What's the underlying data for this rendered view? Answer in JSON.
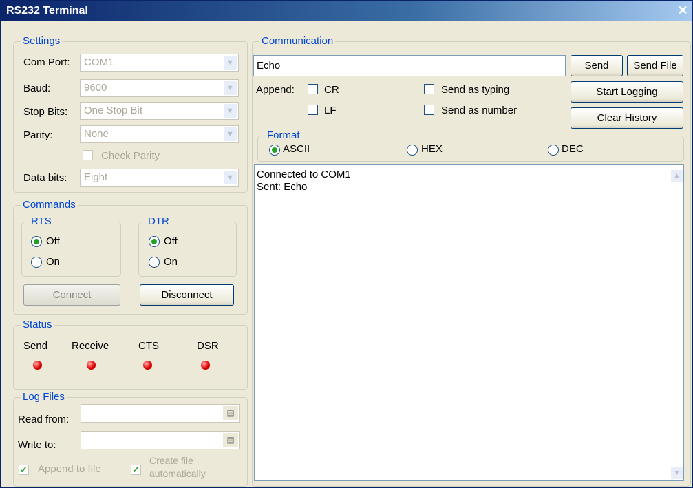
{
  "window": {
    "title": "RS232 Terminal",
    "close": "✕"
  },
  "settings": {
    "legend": "Settings",
    "com_port": {
      "label": "Com Port:",
      "value": "COM1"
    },
    "baud": {
      "label": "Baud:",
      "value": "9600"
    },
    "stop_bits": {
      "label": "Stop Bits:",
      "value": "One Stop Bit"
    },
    "parity": {
      "label": "Parity:",
      "value": "None"
    },
    "check_parity": "Check Parity",
    "data_bits": {
      "label": "Data bits:",
      "value": "Eight"
    }
  },
  "commands": {
    "legend": "Commands",
    "rts": {
      "legend": "RTS",
      "off": "Off",
      "on": "On",
      "selected": "Off"
    },
    "dtr": {
      "legend": "DTR",
      "off": "Off",
      "on": "On",
      "selected": "Off"
    },
    "connect": "Connect",
    "disconnect": "Disconnect"
  },
  "status": {
    "legend": "Status",
    "indicators": [
      "Send",
      "Receive",
      "CTS",
      "DSR"
    ]
  },
  "log_files": {
    "legend": "Log Files",
    "read_from": "Read from:",
    "write_to": "Write to:",
    "append_to_file": "Append to file",
    "create_file_line1": "Create file",
    "create_file_line2": "automatically"
  },
  "communication": {
    "legend": "Communication",
    "input_value": "Echo",
    "send": "Send",
    "send_file": "Send File",
    "append_label": "Append:",
    "cr": "CR",
    "lf": "LF",
    "send_as_typing": "Send as typing",
    "send_as_number": "Send as number",
    "start_logging": "Start Logging",
    "clear_history": "Clear History",
    "format": {
      "legend": "Format",
      "ascii": "ASCII",
      "hex": "HEX",
      "dec": "DEC",
      "selected": "ASCII"
    },
    "log_lines": [
      "Connected to COM1",
      "Sent: Echo"
    ]
  }
}
